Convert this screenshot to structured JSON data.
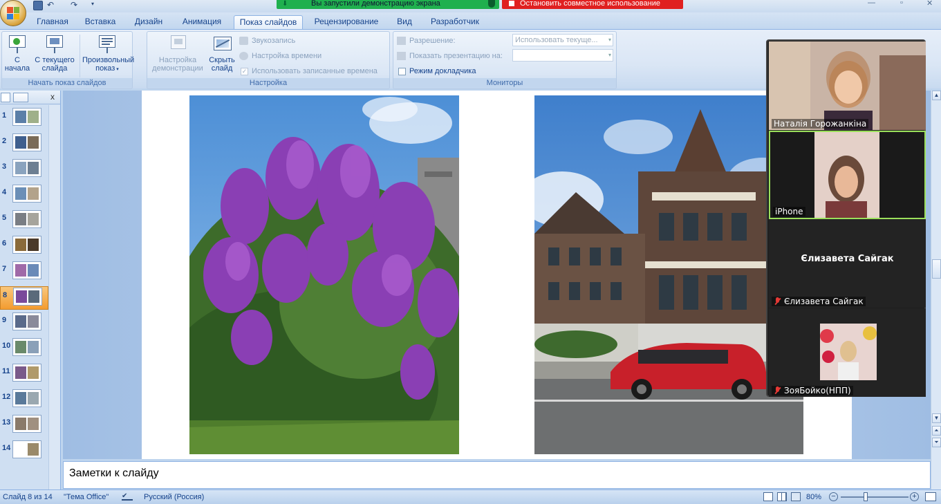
{
  "quick_access": {
    "icons": [
      "save-icon",
      "undo-icon",
      "redo-icon",
      "customize-icon"
    ]
  },
  "share_banner": {
    "sharing_text": "Вы запустили демонстрацию экрана",
    "stop_text": "Остановить совместное использование"
  },
  "tabs": [
    {
      "label": "Главная"
    },
    {
      "label": "Вставка"
    },
    {
      "label": "Дизайн"
    },
    {
      "label": "Анимация"
    },
    {
      "label": "Показ слайдов",
      "active": true
    },
    {
      "label": "Рецензирование"
    },
    {
      "label": "Вид"
    },
    {
      "label": "Разработчик"
    }
  ],
  "ribbon": {
    "start_group": {
      "label": "Начать показ слайдов",
      "from_start_l1": "С",
      "from_start_l2": "начала",
      "from_current_l1": "С текущего",
      "from_current_l2": "слайда",
      "custom_l1": "Произвольный",
      "custom_l2": "показ"
    },
    "setup_group": {
      "label": "Настройка",
      "setup_show_l1": "Настройка",
      "setup_show_l2": "демонстрации",
      "hide_l1": "Скрыть",
      "hide_l2": "слайд",
      "record_narration": "Звукозапись",
      "rehearse_timings": "Настройка времени",
      "use_timings": "Использовать записанные времена"
    },
    "monitors_group": {
      "label": "Мониторы",
      "resolution_label": "Разрешение:",
      "resolution_value": "Использовать текуще...",
      "show_on_label": "Показать презентацию на:",
      "show_on_value": "",
      "presenter_view": "Режим докладчика"
    }
  },
  "slides_pane": {
    "close": "x",
    "selected": 8,
    "slides": [
      {
        "num": "1",
        "colors": [
          "#5b7fa8",
          "#9fb08a"
        ]
      },
      {
        "num": "2",
        "colors": [
          "#3f5f8e",
          "#7a6b58"
        ]
      },
      {
        "num": "3",
        "colors": [
          "#8aa3be",
          "#6d7f92"
        ]
      },
      {
        "num": "4",
        "colors": [
          "#6b8fb7",
          "#b3a38b"
        ]
      },
      {
        "num": "5",
        "colors": [
          "#7a7e84",
          "#a6a49c"
        ]
      },
      {
        "num": "6",
        "colors": [
          "#8a6a3a",
          "#4a3a2a"
        ]
      },
      {
        "num": "7",
        "colors": [
          "#a06aa8",
          "#6a8ab8"
        ]
      },
      {
        "num": "8",
        "colors": [
          "#7a4a9a",
          "#5a6a7a"
        ]
      },
      {
        "num": "9",
        "colors": [
          "#5a6a8a",
          "#8a8a9a"
        ]
      },
      {
        "num": "10",
        "colors": [
          "#6a8a6a",
          "#8aa0b8"
        ]
      },
      {
        "num": "11",
        "colors": [
          "#7a5a8a",
          "#b09a6a"
        ]
      },
      {
        "num": "12",
        "colors": [
          "#5a7a9a",
          "#9aa8b0"
        ]
      },
      {
        "num": "13",
        "colors": [
          "#8a7a6a",
          "#a09080"
        ]
      },
      {
        "num": "14",
        "colors": [
          "#ffffff",
          "#9a8a6a"
        ]
      }
    ]
  },
  "notes": {
    "placeholder": "Заметки к слайду"
  },
  "status_bar": {
    "slide_info": "Слайд 8 из 14",
    "theme": "\"Тема Office\"",
    "language": "Русский (Россия)",
    "zoom": "80%"
  },
  "meeting_panel": {
    "participants": [
      {
        "name": "Наталія Горожанкіна",
        "video": true,
        "muted": false
      },
      {
        "name": "iPhone",
        "video": true,
        "muted": false,
        "active_speaker": true
      },
      {
        "name": "Єлизавета Сайгак",
        "video": false,
        "muted": true,
        "center_name": "Єлизавета Сайгак"
      },
      {
        "name": "ЗояБойко(НПП)",
        "video": true,
        "muted": true
      }
    ]
  },
  "colors": {
    "accent": "#15428b",
    "ribbon_bg": "#dae6f5",
    "share_green": "#1fb04e",
    "share_red": "#e02020",
    "active_speaker": "#9be05b"
  }
}
